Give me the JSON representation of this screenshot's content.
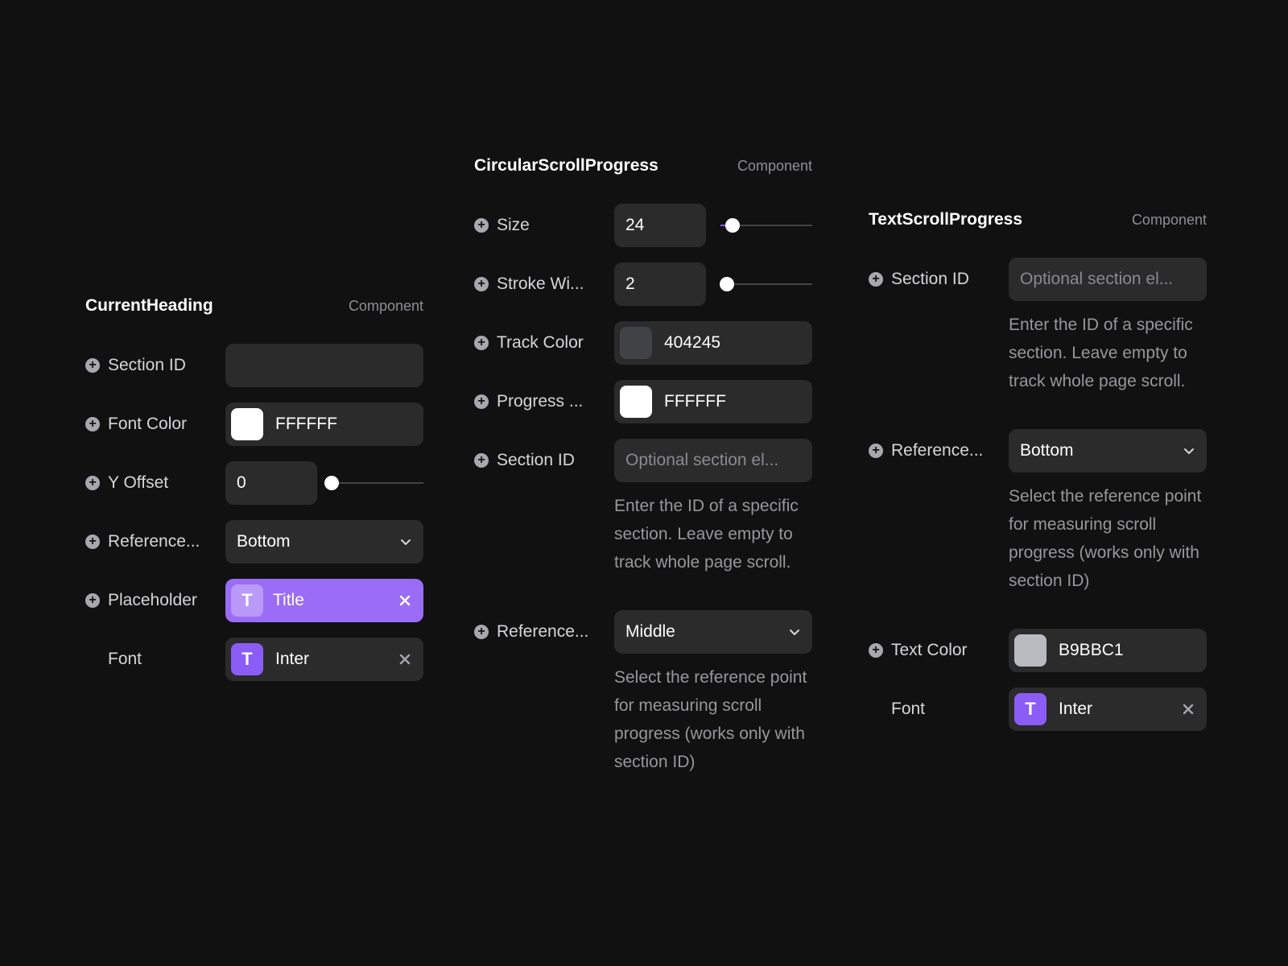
{
  "component_label": "Component",
  "current_heading": {
    "title": "CurrentHeading",
    "section_id_label": "Section ID",
    "section_id_value": "",
    "font_color_label": "Font Color",
    "font_color_value": "FFFFFF",
    "font_color_swatch": "#FFFFFF",
    "y_offset_label": "Y Offset",
    "y_offset_value": "0",
    "y_offset_slider_fraction": 0,
    "reference_label": "Reference...",
    "reference_value": "Bottom",
    "placeholder_label": "Placeholder",
    "placeholder_value": "Title",
    "font_label": "Font",
    "font_value": "Inter"
  },
  "circular": {
    "title": "CircularScrollProgress",
    "size_label": "Size",
    "size_value": "24",
    "size_slider_fraction": 0.13,
    "stroke_label": "Stroke Wi...",
    "stroke_value": "2",
    "stroke_slider_fraction": 0.07,
    "track_color_label": "Track Color",
    "track_color_value": "404245",
    "track_color_swatch": "#404245",
    "progress_label": "Progress ...",
    "progress_value": "FFFFFF",
    "progress_swatch": "#FFFFFF",
    "section_id_label": "Section ID",
    "section_id_placeholder": "Optional section el...",
    "section_id_help": "Enter the ID of a specific section. Leave empty to track whole page scroll.",
    "reference_label": "Reference...",
    "reference_value": "Middle",
    "reference_help": "Select the reference point for measuring scroll progress (works only with section ID)"
  },
  "text_scroll": {
    "title": "TextScrollProgress",
    "section_id_label": "Section ID",
    "section_id_placeholder": "Optional section el...",
    "section_id_help": "Enter the ID of a specific section. Leave empty to track whole page scroll.",
    "reference_label": "Reference...",
    "reference_value": "Bottom",
    "reference_help": "Select the reference point for measuring scroll progress (works only with section ID)",
    "text_color_label": "Text Color",
    "text_color_value": "B9BBC1",
    "text_color_swatch": "#B9BBC1",
    "font_label": "Font",
    "font_value": "Inter"
  },
  "icons": {
    "add": "plus-circle-icon",
    "font": "text-T-icon",
    "remove": "close-icon",
    "dropdown": "chevron-down-icon"
  },
  "colors": {
    "background": "#111111",
    "field": "#2B2B2C",
    "accent": "#8B5CF6",
    "accent_active": "#9B6CF6"
  }
}
